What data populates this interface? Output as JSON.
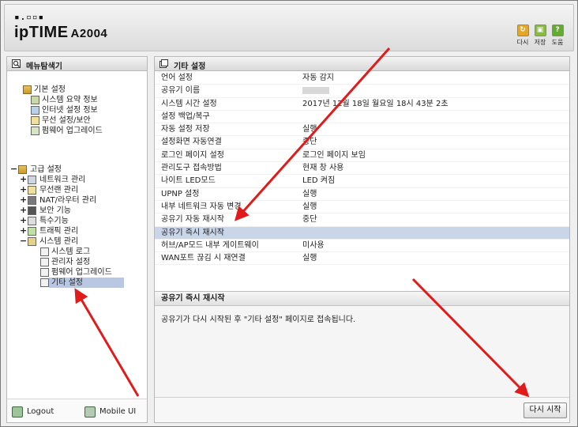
{
  "header": {
    "logo_dots": "▪.▫▫▪",
    "brand": "ipTIME",
    "model": "A2004",
    "buttons": [
      {
        "label": "다시",
        "icon": "refresh-icon",
        "color": "#e5a72a"
      },
      {
        "label": "저장",
        "icon": "save-icon",
        "color": "#88bb44"
      },
      {
        "label": "도움",
        "icon": "help-icon",
        "color": "#66aa33"
      }
    ]
  },
  "left": {
    "title": "메뉴탐색기",
    "basic": {
      "label": "기본 설정",
      "items": [
        "시스템 요약 정보",
        "인터넷 설정 정보",
        "무선 설정/보안",
        "펌웨어 업그레이드"
      ]
    },
    "advanced": {
      "toggle": "−",
      "label": "고급 설정",
      "items": [
        {
          "toggle": "+",
          "label": "네트워크 관리"
        },
        {
          "toggle": "+",
          "label": "무선랜 관리"
        },
        {
          "toggle": "+",
          "label": "NAT/라우터 관리"
        },
        {
          "toggle": "+",
          "label": "보안 기능"
        },
        {
          "toggle": "+",
          "label": "특수기능"
        },
        {
          "toggle": "+",
          "label": "트래픽 관리"
        },
        {
          "toggle": "−",
          "label": "시스템 관리"
        }
      ],
      "system_items": [
        "시스템 로그",
        "관리자 설정",
        "펌웨어 업그레이드",
        "기타 설정"
      ],
      "selected": "기타 설정"
    },
    "logout_label": "Logout",
    "mobile_label": "Mobile UI"
  },
  "right": {
    "title": "기타 설정",
    "rows": [
      {
        "key": "언어 설정",
        "value": "자동 감지"
      },
      {
        "key": "공유기 이름",
        "value": ""
      },
      {
        "key": "시스템 시간 설정",
        "value": "2017년 12월 18일 월요일 18시 43분 2초"
      },
      {
        "key": "설정 백업/복구",
        "value": ""
      },
      {
        "key": "자동 설정 저장",
        "value": "실행"
      },
      {
        "key": "설정화면 자동연결",
        "value": "중단"
      },
      {
        "key": "로그인 페이지 설정",
        "value": "로그인 페이지 보임"
      },
      {
        "key": "관리도구 접속방법",
        "value": "현재 창 사용"
      },
      {
        "key": "나이트 LED모드",
        "value": "LED 켜짐"
      },
      {
        "key": "UPNP 설정",
        "value": "실행"
      },
      {
        "key": "내부 네트워크 자동 변경",
        "value": "실행"
      },
      {
        "key": "공유기 자동 재시작",
        "value": "중단"
      },
      {
        "key": "공유기 즉시 재시작",
        "value": ""
      },
      {
        "key": "허브/AP모드 내부 게이트웨이",
        "value": "미사용"
      },
      {
        "key": "WAN포트 끊김 시 재연결",
        "value": "실행"
      }
    ],
    "selected_row": "공유기 즉시 재시작",
    "desc_title": "공유기 즉시 재시작",
    "desc_text": "공유기가 다시 시작된 후 \"기타 설정\" 페이지로 접속됩니다.",
    "restart_label": "다시 시작"
  },
  "colors": {
    "arrow": "#e11b1b",
    "selected_row": "#c9d6ea",
    "selected_tree": "#b8c8e3"
  }
}
